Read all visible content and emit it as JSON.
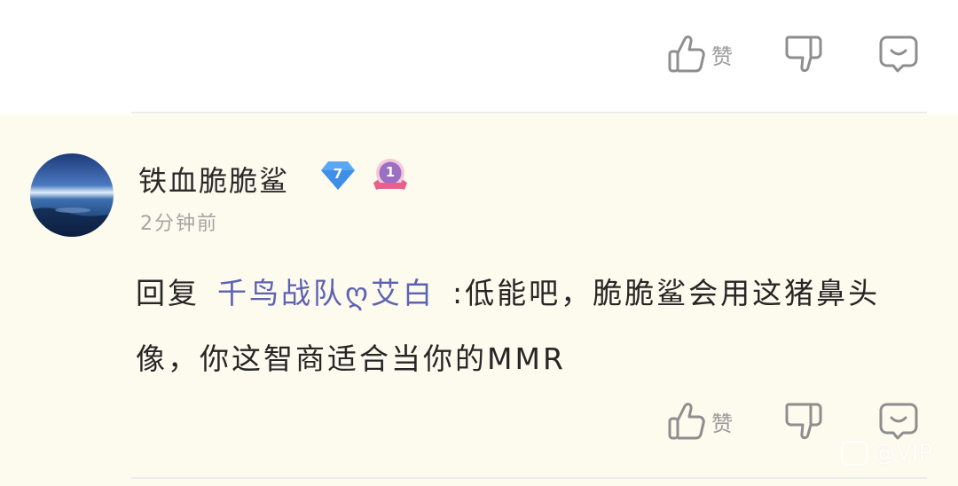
{
  "prev_comment": {
    "like_label": "赞"
  },
  "comment": {
    "username": "铁血脆脆鲨",
    "level": "7",
    "rank": "1",
    "time": "2分钟前",
    "reply_prefix": "回复",
    "mention": "千鸟战队ღ艾白",
    "body": ":低能吧，脆脆鲨会用这猪鼻头像，你这智商适合当你的MMR",
    "like_label": "赞"
  },
  "watermark": {
    "text": "@VIP"
  },
  "colors": {
    "comment_background": "#fdfaee",
    "mention": "#5d62b3",
    "level_badge": "#5aa8f5",
    "rank_badge": "#9b6fc4",
    "icon_gray": "#8e8e8e"
  }
}
